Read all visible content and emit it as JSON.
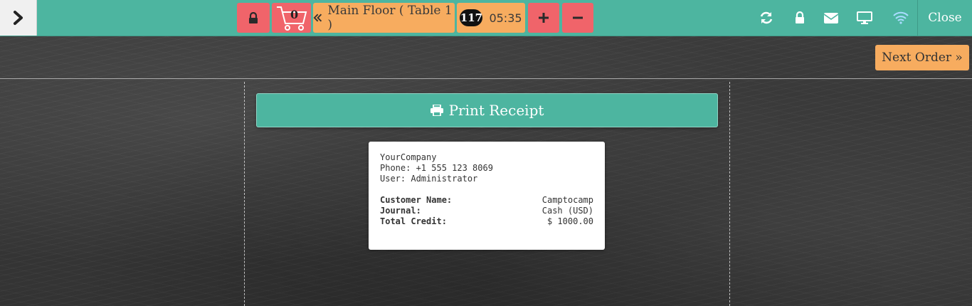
{
  "topbar": {
    "order_label": "Main Floor ( Table 1 )",
    "cart_count": "0",
    "order_number": "117",
    "order_time": "05:35",
    "close_label": "Close",
    "colors": {
      "bar": "#4db5a0",
      "red": "#f0646a",
      "orange": "#f7ac5f"
    },
    "icons": [
      "chevron-right-icon",
      "lock-icon",
      "cart-icon",
      "double-chevron-left-icon",
      "plus-icon",
      "minus-icon",
      "refresh-icon",
      "lock-icon",
      "envelope-icon",
      "monitor-icon",
      "wifi-icon"
    ]
  },
  "next_order_label": "Next Order »",
  "print_button_label": "Print Receipt",
  "receipt": {
    "company": "YourCompany",
    "phone": "Phone: +1 555 123 8069",
    "user": "User: Administrator",
    "rows": [
      {
        "key": "Customer Name:",
        "value": "Camptocamp"
      },
      {
        "key": "Journal:",
        "value": "Cash (USD)"
      },
      {
        "key": "Total Credit:",
        "value": "$ 1000.00"
      }
    ]
  }
}
